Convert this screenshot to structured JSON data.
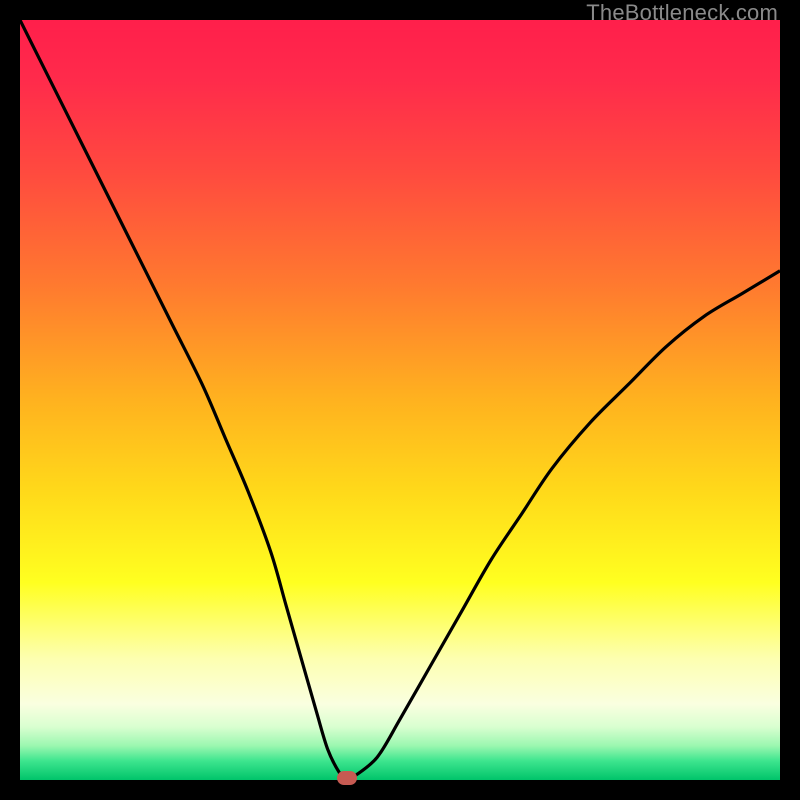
{
  "watermark": "TheBottleneck.com",
  "colors": {
    "gradient_stops": [
      {
        "offset": 0.0,
        "color": "#ff1f4b"
      },
      {
        "offset": 0.08,
        "color": "#ff2b4b"
      },
      {
        "offset": 0.2,
        "color": "#ff4a3f"
      },
      {
        "offset": 0.35,
        "color": "#ff7a2f"
      },
      {
        "offset": 0.5,
        "color": "#ffb21f"
      },
      {
        "offset": 0.62,
        "color": "#ffd91a"
      },
      {
        "offset": 0.74,
        "color": "#ffff20"
      },
      {
        "offset": 0.84,
        "color": "#fdffb0"
      },
      {
        "offset": 0.9,
        "color": "#faffe0"
      },
      {
        "offset": 0.93,
        "color": "#d9ffd0"
      },
      {
        "offset": 0.955,
        "color": "#9bf7b0"
      },
      {
        "offset": 0.975,
        "color": "#3de58e"
      },
      {
        "offset": 1.0,
        "color": "#00c46a"
      }
    ],
    "curve": "#000000",
    "marker": "#c65a52",
    "frame_bg": "#000000"
  },
  "chart_data": {
    "type": "line",
    "title": "",
    "xlabel": "",
    "ylabel": "",
    "xlim": [
      0,
      100
    ],
    "ylim": [
      0,
      100
    ],
    "series": [
      {
        "name": "bottleneck-curve",
        "x": [
          0,
          4,
          8,
          12,
          16,
          20,
          24,
          27,
          30,
          33,
          35,
          37,
          39,
          40.5,
          42,
          43,
          44,
          47,
          50,
          54,
          58,
          62,
          66,
          70,
          75,
          80,
          85,
          90,
          95,
          100
        ],
        "y": [
          100,
          92,
          84,
          76,
          68,
          60,
          52,
          45,
          38,
          30,
          23,
          16,
          9,
          4,
          1,
          0,
          0.5,
          3,
          8,
          15,
          22,
          29,
          35,
          41,
          47,
          52,
          57,
          61,
          64,
          67
        ]
      }
    ],
    "marker": {
      "x": 43,
      "y": 0,
      "name": "optimal-point"
    }
  }
}
